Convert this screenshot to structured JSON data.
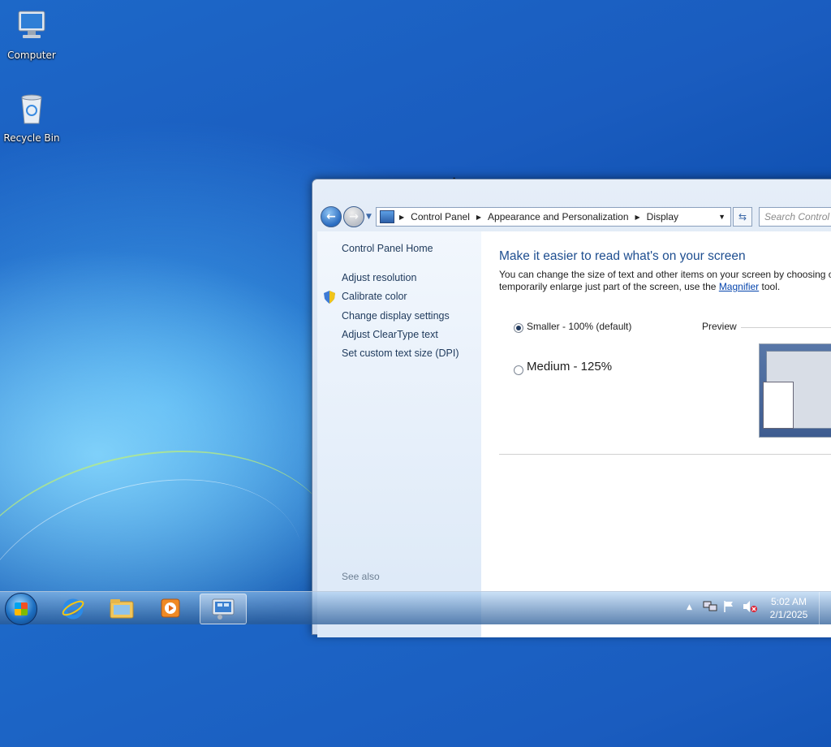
{
  "desktop": {
    "icons": [
      {
        "label": "Computer"
      },
      {
        "label": "Recycle Bin"
      }
    ]
  },
  "window": {
    "address": {
      "crumbs": [
        "Control Panel",
        "Appearance and Personalization",
        "Display"
      ]
    },
    "search_placeholder": "Search Control Panel",
    "sidebar": {
      "home": "Control Panel Home",
      "items": [
        "Adjust resolution",
        "Calibrate color",
        "Change display settings",
        "Adjust ClearType text",
        "Set custom text size (DPI)"
      ],
      "see_also": "See also"
    },
    "main": {
      "heading": "Make it easier to read what's on your screen",
      "desc_line1": "You can change the size of text and other items on your screen by choosing o",
      "desc_line2_pre": "temporarily enlarge just part of the screen, use the ",
      "desc_link": "Magnifier",
      "desc_line2_post": " tool.",
      "options": [
        {
          "label": "Smaller - 100% (default)",
          "selected": true
        },
        {
          "label": "Medium - 125%",
          "selected": false
        }
      ],
      "preview_label": "Preview"
    }
  },
  "taskbar": {
    "time": "5:02 AM",
    "date": "2/1/2025",
    "tray_chevron": "▲"
  },
  "colors": {
    "link": "#1e395b",
    "heading": "#1e4e90",
    "accent_link": "#0645ad"
  }
}
